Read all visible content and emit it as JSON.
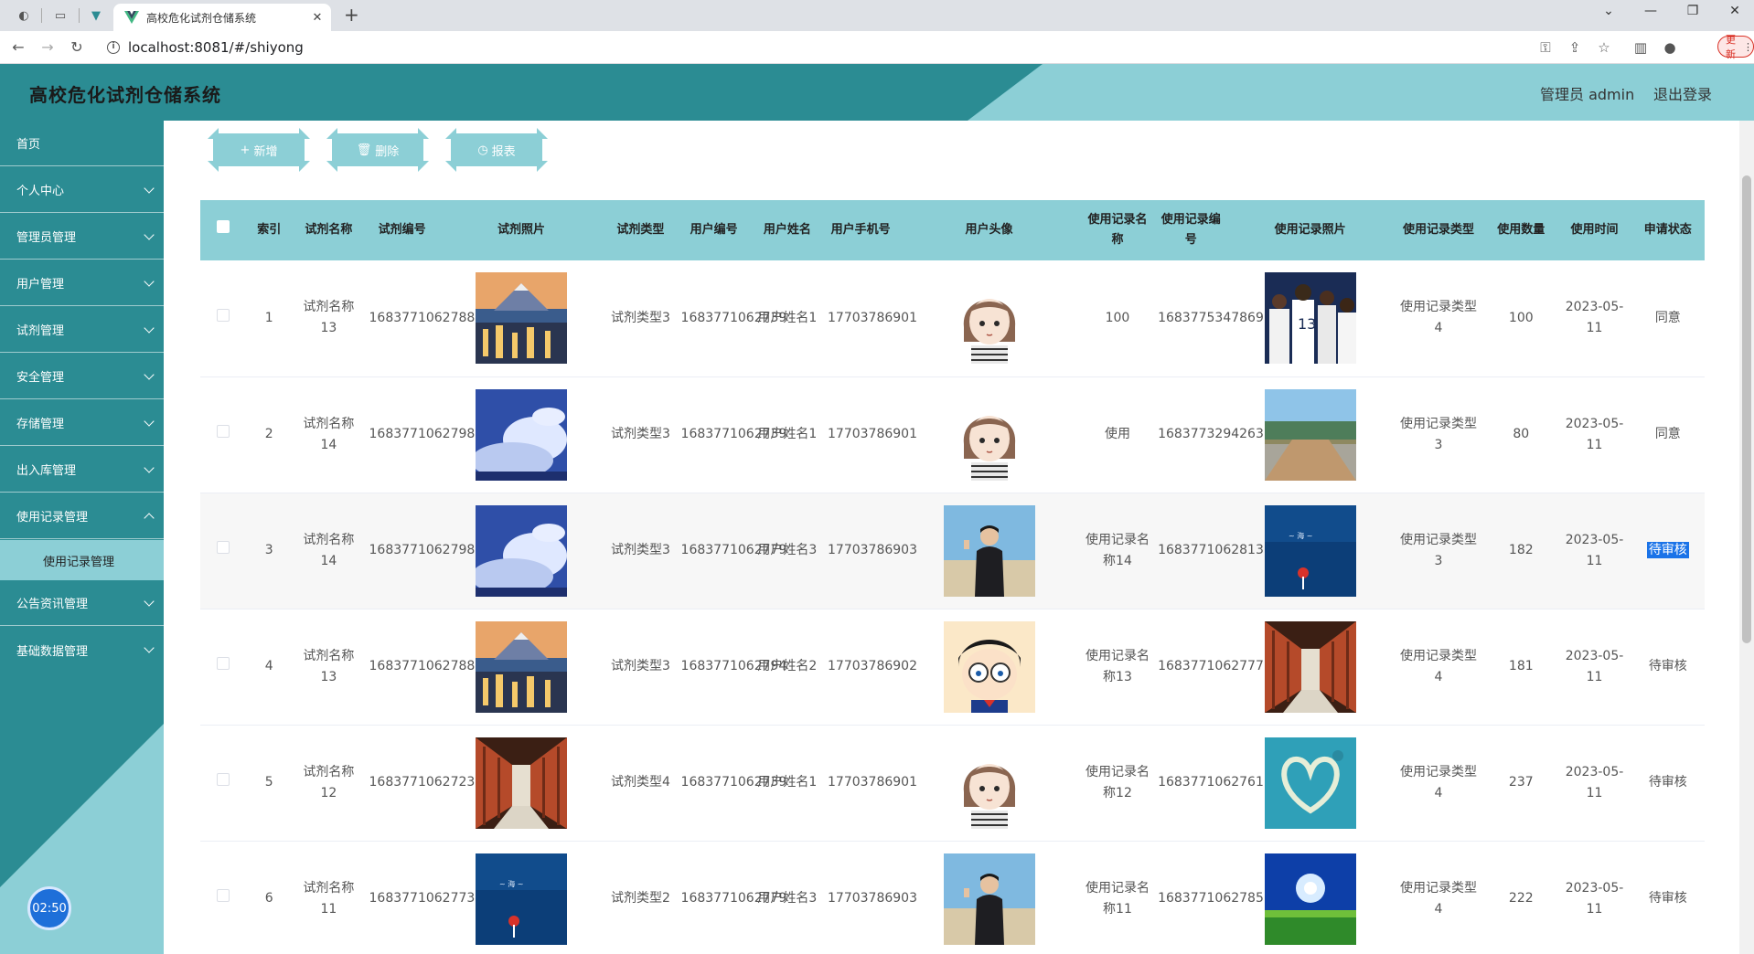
{
  "browser": {
    "tab_title": "高校危化试剂仓储系统",
    "url": "localhost:8081/#/shiyong",
    "update_label": "更新"
  },
  "header": {
    "title": "高校危化试剂仓储系统",
    "user_label": "管理员 admin",
    "logout_label": "退出登录"
  },
  "sidebar": {
    "items": [
      {
        "label": "首页"
      },
      {
        "label": "个人中心"
      },
      {
        "label": "管理员管理"
      },
      {
        "label": "用户管理"
      },
      {
        "label": "试剂管理"
      },
      {
        "label": "安全管理"
      },
      {
        "label": "存储管理"
      },
      {
        "label": "出入库管理"
      },
      {
        "label": "使用记录管理"
      },
      {
        "label": "公告资讯管理"
      },
      {
        "label": "基础数据管理"
      }
    ],
    "submenu": {
      "label": "使用记录管理"
    },
    "timer": "02:50"
  },
  "toolbar": {
    "add_label": "新增",
    "delete_label": "删除",
    "report_label": "报表"
  },
  "table": {
    "headers": [
      "索引",
      "试剂名称",
      "试剂编号",
      "试剂照片",
      "试剂类型",
      "用户编号",
      "用户姓名",
      "用户手机号",
      "用户头像",
      "使用记录名称",
      "使用记录编号",
      "使用记录照片",
      "使用记录类型",
      "使用数量",
      "使用时间",
      "申请状态"
    ],
    "rows": [
      {
        "index": "1",
        "name": "试剂名称13",
        "code": "1683771062788",
        "photo": "city",
        "type": "试剂类型3",
        "user_no": "1683771062739",
        "user_name": "用户姓名1",
        "phone": "17703786901",
        "avatar": "cartoon-girl",
        "rec_name": "100",
        "rec_no": "1683775347869",
        "rec_photo": "basketball",
        "rec_type": "使用记录类型4",
        "qty": "100",
        "time": "2023-05-11",
        "status": "同意"
      },
      {
        "index": "2",
        "name": "试剂名称14",
        "code": "1683771062798",
        "photo": "sky",
        "type": "试剂类型3",
        "user_no": "1683771062739",
        "user_name": "用户姓名1",
        "phone": "17703786901",
        "avatar": "cartoon-girl",
        "rec_name": "使用",
        "rec_no": "1683773294263",
        "rec_photo": "beach",
        "rec_type": "使用记录类型3",
        "qty": "80",
        "time": "2023-05-11",
        "status": "同意"
      },
      {
        "index": "3",
        "name": "试剂名称14",
        "code": "1683771062798",
        "photo": "sky",
        "type": "试剂类型3",
        "user_no": "1683771062779",
        "user_name": "用户姓名3",
        "phone": "17703786903",
        "avatar": "man-photo",
        "rec_name": "使用记录名称14",
        "rec_no": "1683771062813",
        "rec_photo": "sea",
        "rec_type": "使用记录类型3",
        "qty": "182",
        "time": "2023-05-11",
        "status": "待审核"
      },
      {
        "index": "4",
        "name": "试剂名称13",
        "code": "1683771062788",
        "photo": "city",
        "type": "试剂类型3",
        "user_no": "1683771062794",
        "user_name": "用户姓名2",
        "phone": "17703786902",
        "avatar": "conan",
        "rec_name": "使用记录名称13",
        "rec_no": "1683771062777",
        "rec_photo": "corridor",
        "rec_type": "使用记录类型4",
        "qty": "181",
        "time": "2023-05-11",
        "status": "待审核"
      },
      {
        "index": "5",
        "name": "试剂名称12",
        "code": "1683771062723",
        "photo": "corridor",
        "type": "试剂类型4",
        "user_no": "1683771062739",
        "user_name": "用户姓名1",
        "phone": "17703786901",
        "avatar": "cartoon-girl",
        "rec_name": "使用记录名称12",
        "rec_no": "1683771062761",
        "rec_photo": "heart-island",
        "rec_type": "使用记录类型4",
        "qty": "237",
        "time": "2023-05-11",
        "status": "待审核"
      },
      {
        "index": "6",
        "name": "试剂名称11",
        "code": "1683771062773",
        "photo": "sea",
        "type": "试剂类型2",
        "user_no": "1683771062779",
        "user_name": "用户姓名3",
        "phone": "17703786903",
        "avatar": "man-photo",
        "rec_name": "使用记录名称11",
        "rec_no": "1683771062785",
        "rec_photo": "grass-sun",
        "rec_type": "使用记录类型4",
        "qty": "222",
        "time": "2023-05-11",
        "status": "待审核"
      }
    ]
  },
  "colors": {
    "primary": "#2b8c93",
    "light": "#8ccfd6",
    "highlight": "#1a73e8"
  }
}
